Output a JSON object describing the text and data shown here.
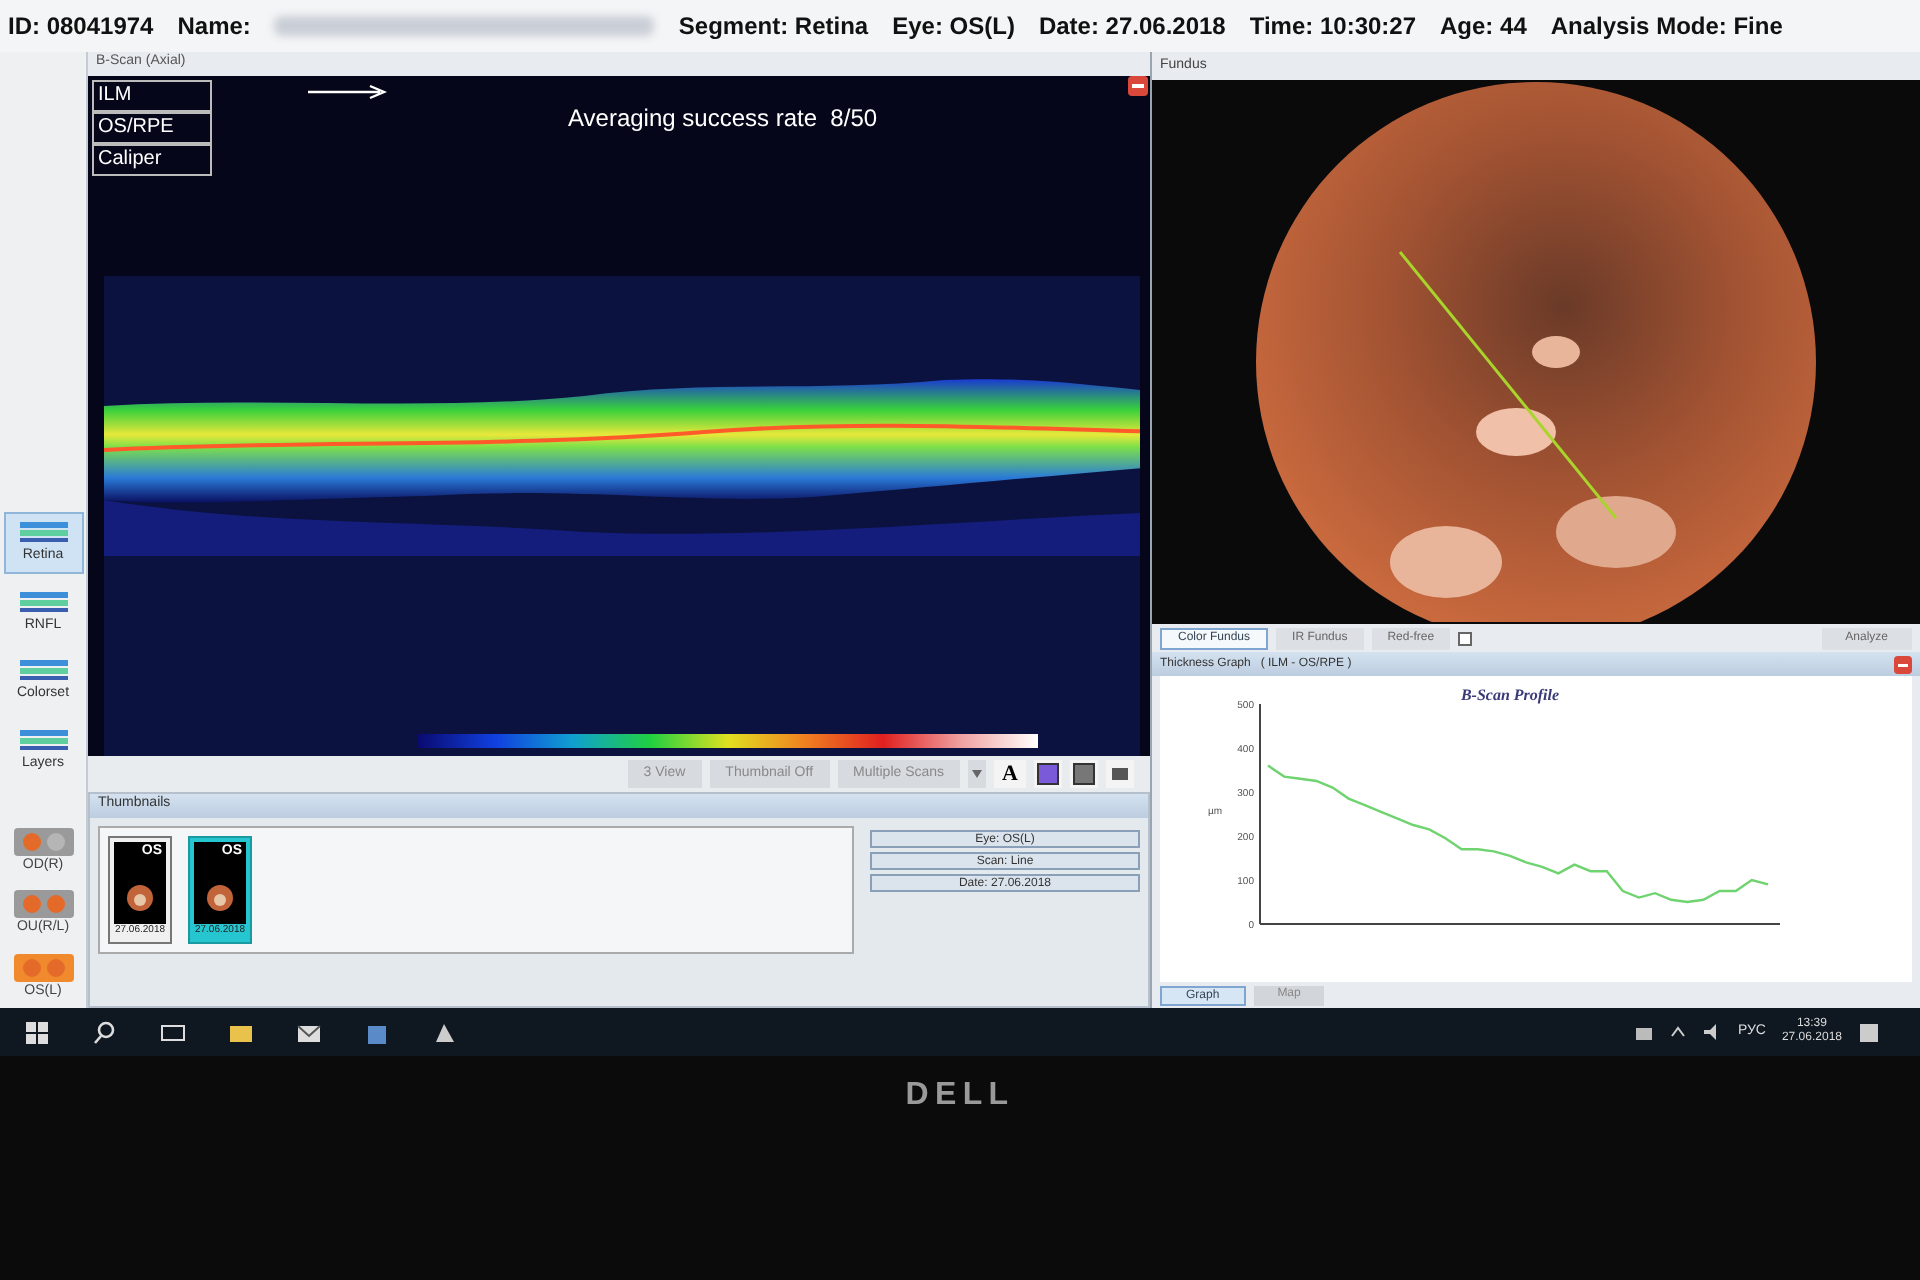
{
  "header": {
    "id": "ID: 08041974",
    "name_label": "Name:",
    "items": [
      "Segment: Retina",
      "Eye: OS(L)",
      "Date: 27.06.2018",
      "Time: 10:30:27",
      "Age: 44",
      "Analysis Mode: Fine"
    ]
  },
  "sidebar": {
    "tools": [
      {
        "label": "Retina",
        "selected": true
      },
      {
        "label": "RNFL",
        "selected": false
      },
      {
        "label": "Colorset",
        "selected": false
      },
      {
        "label": "Layers",
        "selected": false
      }
    ],
    "eyes": [
      {
        "label": "OD(R)",
        "selected": false
      },
      {
        "label": "OU(R/L)",
        "selected": false
      },
      {
        "label": "OS(L)",
        "selected": true
      }
    ]
  },
  "bscan": {
    "title": "B-Scan (Axial)",
    "layer_buttons": [
      "ILM",
      "OS/RPE",
      "Caliper"
    ],
    "averaging": "Averaging success rate  8/50"
  },
  "toolbar": {
    "buttons": [
      "3 View",
      "Thumbnail Off",
      "Multiple Scans"
    ],
    "font_button": "A"
  },
  "thumbnails": {
    "title": "Thumbnails",
    "items": [
      {
        "eye": "OS",
        "date": "27.06.2018",
        "selected": false
      },
      {
        "eye": "OS",
        "date": "27.06.2018",
        "selected": true
      }
    ],
    "info": [
      "Eye: OS(L)",
      "Scan: Line",
      "Date: 27.06.2018"
    ]
  },
  "fundus": {
    "title": "Fundus",
    "modes": [
      {
        "label": "Color Fundus",
        "selected": true
      },
      {
        "label": "IR Fundus",
        "selected": false
      },
      {
        "label": "Red-free",
        "selected": false
      }
    ],
    "red_free_checked": false,
    "analyze": "Analyze"
  },
  "thickness": {
    "title": "Thickness Graph   ( ILM - OS/RPE )",
    "tabs": [
      {
        "label": "Graph",
        "selected": true
      },
      {
        "label": "Map",
        "selected": false
      }
    ],
    "chart_data": {
      "type": "line",
      "title": "B-Scan Profile",
      "ylabel": "µm",
      "ylim": [
        0,
        500
      ],
      "yticks": [
        0,
        100,
        200,
        300,
        400,
        500
      ],
      "series": [
        {
          "color": "#6fd36f",
          "values": [
            360,
            335,
            330,
            325,
            310,
            285,
            270,
            255,
            240,
            225,
            215,
            195,
            170,
            170,
            165,
            155,
            140,
            130,
            115,
            135,
            120,
            120,
            75,
            60,
            70,
            55,
            50,
            55,
            75,
            75,
            100,
            90
          ]
        }
      ]
    }
  },
  "taskbar": {
    "language": "РУС",
    "time": "13:39",
    "date": "27.06.2018"
  },
  "monitor": {
    "brand": "DELL"
  }
}
